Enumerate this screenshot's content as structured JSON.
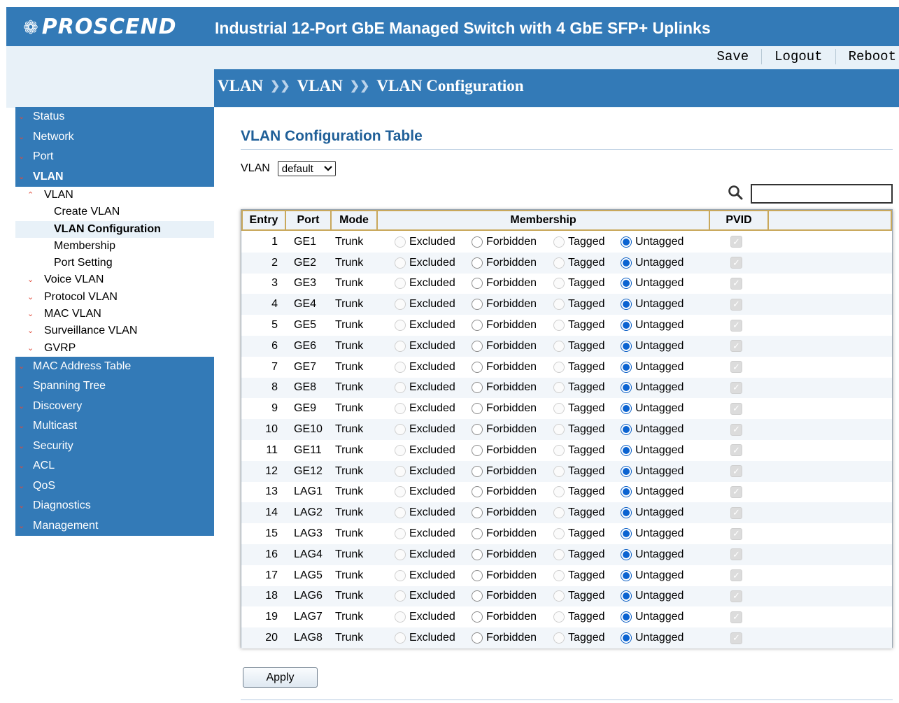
{
  "header": {
    "logo_text": "PROSCEND",
    "product_title": "Industrial 12-Port GbE Managed Switch with 4 GbE SFP+ Uplinks"
  },
  "top_links": [
    "Save",
    "Logout",
    "Reboot"
  ],
  "breadcrumb": [
    "VLAN",
    "VLAN",
    "VLAN Configuration"
  ],
  "sidebar": {
    "top_items": [
      "Status",
      "Network",
      "Port",
      "VLAN"
    ],
    "vlan_sub": {
      "group": "VLAN",
      "leaves": [
        "Create VLAN",
        "VLAN Configuration",
        "Membership",
        "Port Setting"
      ],
      "others": [
        "Voice VLAN",
        "Protocol VLAN",
        "MAC VLAN",
        "Surveillance VLAN",
        "GVRP"
      ]
    },
    "bottom_items": [
      "MAC Address Table",
      "Spanning Tree",
      "Discovery",
      "Multicast",
      "Security",
      "ACL",
      "QoS",
      "Diagnostics",
      "Management"
    ]
  },
  "main": {
    "title": "VLAN Configuration Table",
    "vlan_label": "VLAN",
    "vlan_selected": "default",
    "search_value": "",
    "apply_label": "Apply"
  },
  "table": {
    "headers": [
      "Entry",
      "Port",
      "Mode",
      "Membership",
      "PVID"
    ],
    "membership_options": [
      "Excluded",
      "Forbidden",
      "Tagged",
      "Untagged"
    ],
    "rows": [
      {
        "entry": "1",
        "port": "GE1",
        "mode": "Trunk",
        "membership": "Untagged",
        "pvid": true
      },
      {
        "entry": "2",
        "port": "GE2",
        "mode": "Trunk",
        "membership": "Untagged",
        "pvid": true
      },
      {
        "entry": "3",
        "port": "GE3",
        "mode": "Trunk",
        "membership": "Untagged",
        "pvid": true
      },
      {
        "entry": "4",
        "port": "GE4",
        "mode": "Trunk",
        "membership": "Untagged",
        "pvid": true
      },
      {
        "entry": "5",
        "port": "GE5",
        "mode": "Trunk",
        "membership": "Untagged",
        "pvid": true
      },
      {
        "entry": "6",
        "port": "GE6",
        "mode": "Trunk",
        "membership": "Untagged",
        "pvid": true
      },
      {
        "entry": "7",
        "port": "GE7",
        "mode": "Trunk",
        "membership": "Untagged",
        "pvid": true
      },
      {
        "entry": "8",
        "port": "GE8",
        "mode": "Trunk",
        "membership": "Untagged",
        "pvid": true
      },
      {
        "entry": "9",
        "port": "GE9",
        "mode": "Trunk",
        "membership": "Untagged",
        "pvid": true
      },
      {
        "entry": "10",
        "port": "GE10",
        "mode": "Trunk",
        "membership": "Untagged",
        "pvid": true
      },
      {
        "entry": "11",
        "port": "GE11",
        "mode": "Trunk",
        "membership": "Untagged",
        "pvid": true
      },
      {
        "entry": "12",
        "port": "GE12",
        "mode": "Trunk",
        "membership": "Untagged",
        "pvid": true
      },
      {
        "entry": "13",
        "port": "LAG1",
        "mode": "Trunk",
        "membership": "Untagged",
        "pvid": true
      },
      {
        "entry": "14",
        "port": "LAG2",
        "mode": "Trunk",
        "membership": "Untagged",
        "pvid": true
      },
      {
        "entry": "15",
        "port": "LAG3",
        "mode": "Trunk",
        "membership": "Untagged",
        "pvid": true
      },
      {
        "entry": "16",
        "port": "LAG4",
        "mode": "Trunk",
        "membership": "Untagged",
        "pvid": true
      },
      {
        "entry": "17",
        "port": "LAG5",
        "mode": "Trunk",
        "membership": "Untagged",
        "pvid": true
      },
      {
        "entry": "18",
        "port": "LAG6",
        "mode": "Trunk",
        "membership": "Untagged",
        "pvid": true
      },
      {
        "entry": "19",
        "port": "LAG7",
        "mode": "Trunk",
        "membership": "Untagged",
        "pvid": true
      },
      {
        "entry": "20",
        "port": "LAG8",
        "mode": "Trunk",
        "membership": "Untagged",
        "pvid": true
      }
    ]
  },
  "colors": {
    "brand_blue": "#337ab7",
    "title_blue": "#1f5f98",
    "chevron_red": "#e04a3a",
    "header_border": "#c9a85b"
  }
}
